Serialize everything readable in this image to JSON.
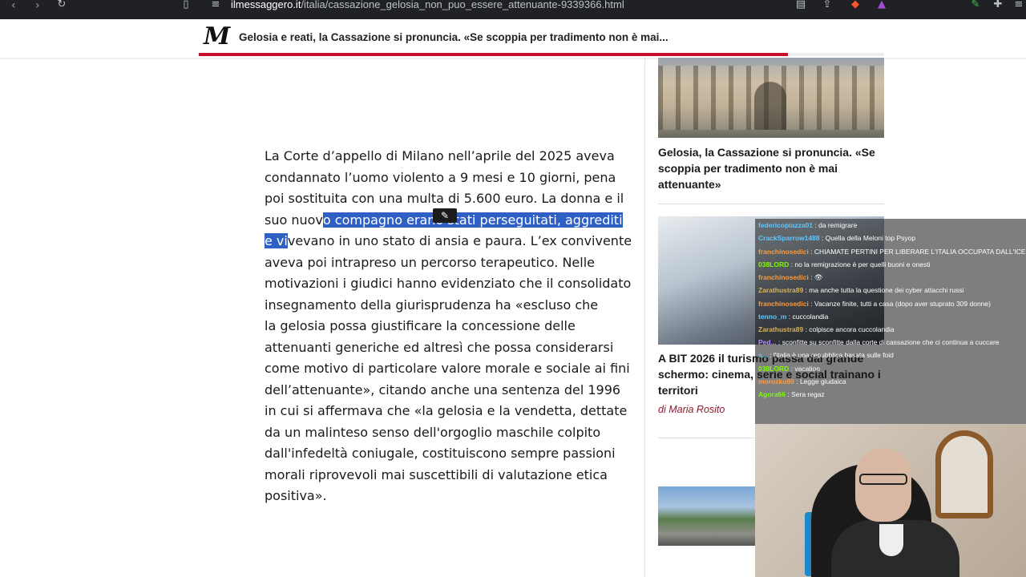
{
  "browser": {
    "url_host": "ilmessaggero.it",
    "url_path": "/italia/cassazione_gelosia_non_puo_essere_attenuante-9339366.html"
  },
  "header": {
    "logo": "M",
    "title": "Gelosia e reati, la Cassazione si pronuncia. «Se scoppia per tradimento non è mai...",
    "reading_progress": 0.86,
    "accent_color": "#c8102e"
  },
  "article": {
    "p1_before": "La Corte d’appello di Milano nell’aprile del 2025 aveva condannato l’uomo violento a 9 mesi e 10 giorni, pena poi sostituita con una multa di 5.600 euro. La donna e il suo nuov",
    "p1_highlight": "o compagno erano stati perseguitati, aggrediti e vi",
    "p1_after": "vevano in uno stato di ansia e paura. L’ex convivente aveva poi intrapreso un percorso terapeutico. Nelle motivazioni i giudici hanno evidenziato che il consolidato insegnamento della giurisprudenza ha «escluso che",
    "p2": "la gelosia possa giustificare la concessione delle attenuanti generiche ed altresì che possa considerarsi come motivo di particolare valore morale e sociale ai fini dell’attenuante», citando anche una sentenza del 1996 in cui si affermava che «la gelosia e la vendetta, dettate da un malinteso senso dell'orgoglio maschile colpito dall'infedeltà coniugale, costituiscono sempre passioni morali riprovevoli mai suscettibili di valutazione etica positiva».",
    "highlight_color": "#2d5fc4"
  },
  "sidebar": {
    "card1_title": "Gelosia, la Cassazione si pronuncia. «Se scoppia per tradimento non è mai attenuante»",
    "card2_title": "A BIT 2026 il turismo passa dal grande schermo: cinema, serie e social trainano i territori",
    "card2_author": "di Maria Rosito"
  },
  "chat": {
    "messages": [
      {
        "user": "federicopiazza01",
        "text": ": da remigrare",
        "color": "#5ec8ff"
      },
      {
        "user": "CrackSparrow1488",
        "text": ": Quella della Meloni top Psyop",
        "color": "#5ec8ff"
      },
      {
        "user": "franchinosedici",
        "text": ": CHIAMATE PERTINI PER LIBERARE L'ITALIA OCCUPATA DALL'ICE",
        "color": "#ff9a3c"
      },
      {
        "user": "038LORD",
        "text": ": no la remigrazione è per quelli buoni e onesti",
        "color": "#7CFC00"
      },
      {
        "user": "franchinosedici",
        "text": ": 👁",
        "color": "#ff9a3c"
      },
      {
        "user": "Zarathustra89",
        "text": ": ma anche tutta la questione dei cyber attacchi russi",
        "color": "#d6b35a"
      },
      {
        "user": "franchinosedici",
        "text": ": Vacanze finite, tutti a casa (dopo aver stuprato 309 donne)",
        "color": "#ff9a3c"
      },
      {
        "user": "tenno_m",
        "text": ": cuccolandia",
        "color": "#5ec8ff"
      },
      {
        "user": "Zarathustra89",
        "text": ": colpisce ancora cuccolandia",
        "color": "#d6b35a"
      },
      {
        "user": "Ped...",
        "text": ": sconfitte su sconfitte dalla corte di cassazione che ci continua a cuccare",
        "color": "#b48cff"
      },
      {
        "user": "s...",
        "text": ": l'italia è una repubblica basata sulle foid",
        "color": "#5ec8ff"
      },
      {
        "user": "038LORD",
        "text": ": vacation",
        "color": "#7CFC00"
      },
      {
        "user": "morozko99",
        "text": ": Legge giudaica",
        "color": "#ff9a3c"
      },
      {
        "user": "Agora66",
        "text": ": Sera regaz",
        "color": "#7CFC00"
      }
    ]
  }
}
